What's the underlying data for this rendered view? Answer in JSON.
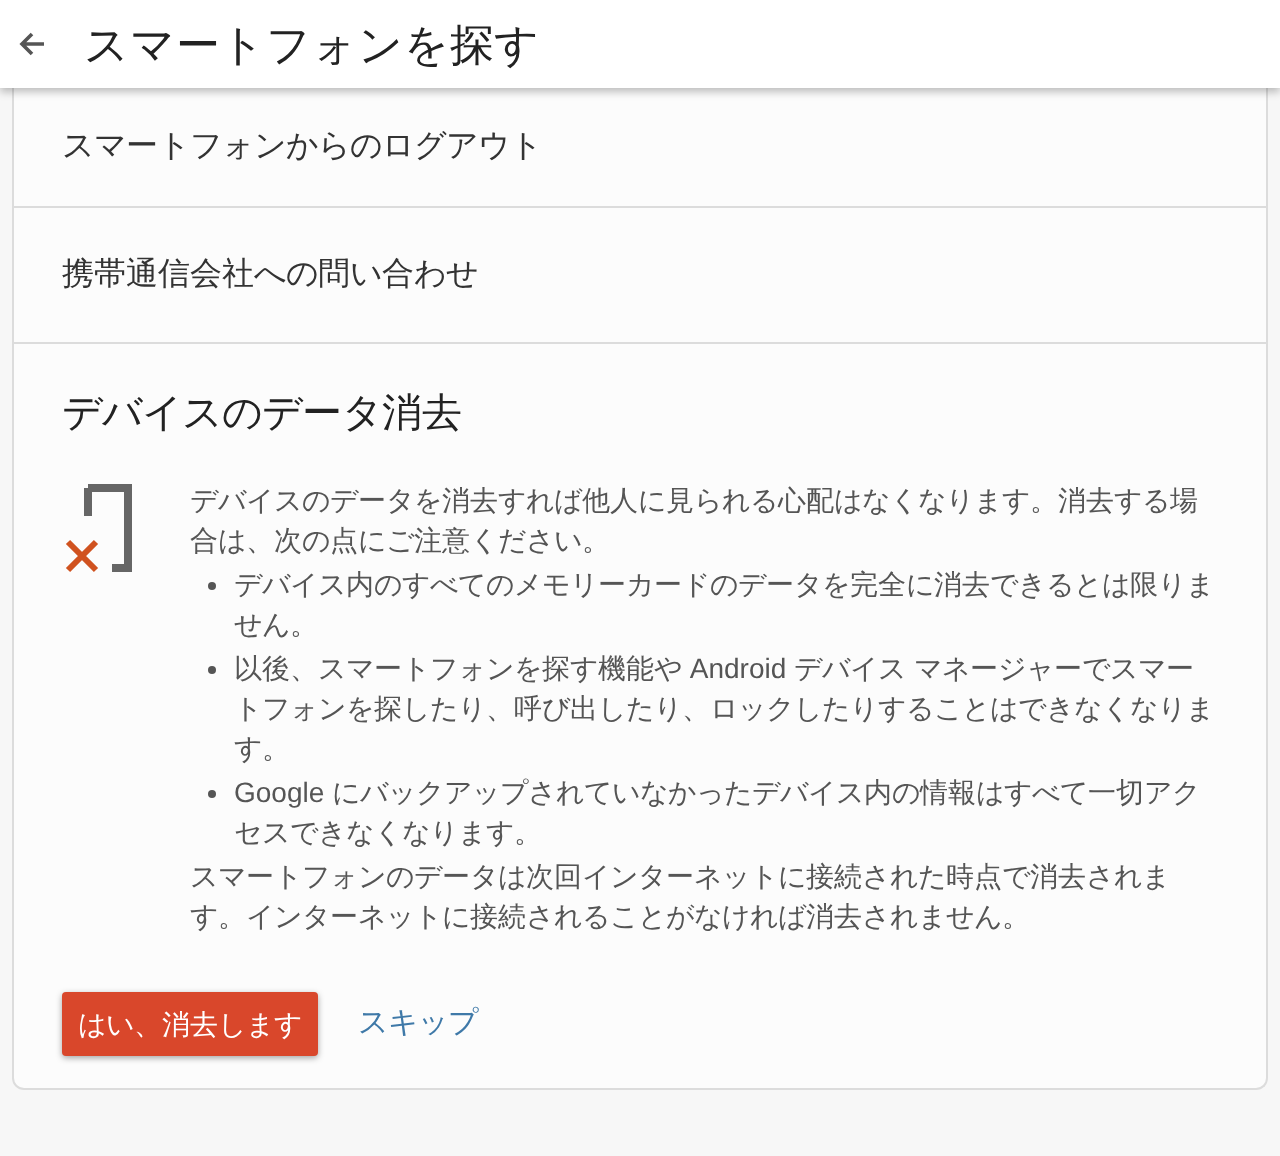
{
  "header": {
    "title": "スマートフォンを探す"
  },
  "menu_items": [
    "スマートフォンからのログアウト",
    "携帯通信会社への問い合わせ"
  ],
  "erase_section": {
    "title": "デバイスのデータ消去",
    "intro": "デバイスのデータを消去すれば他人に見られる心配はなくなります。消去する場合は、次の点にご注意ください。",
    "bullets": [
      "デバイス内のすべてのメモリーカードのデータを完全に消去できるとは限りません。",
      "以後、スマートフォンを探す機能や Android デバイス マネージャーでスマートフォンを探したり、呼び出したり、ロックしたりすることはできなくなります。",
      "Google にバックアップされていなかったデバイス内の情報はすべて一切アクセスできなくなります。"
    ],
    "note": "スマートフォンのデータは次回インターネットに接続された時点で消去されます。インターネットに接続されることがなければ消去されません。",
    "confirm_button": "はい、消去します",
    "skip_link": "スキップ"
  }
}
